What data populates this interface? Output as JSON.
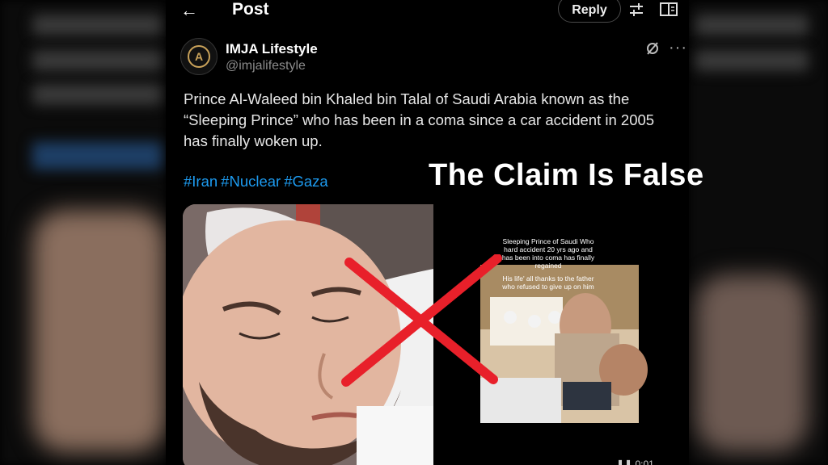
{
  "header": {
    "back_icon": "arrow-left-icon",
    "title": "Post",
    "reply_label": "Reply",
    "filter_icon": "sliders-icon",
    "reader_icon": "book-icon"
  },
  "post": {
    "author": "IMJA Lifestyle",
    "handle": "@imjalifestyle",
    "avatar_letter": "A",
    "text_line1": "Prince Al-Waleed bin Khaled bin Talal of Saudi Arabia known as the",
    "text_line2": "“Sleeping Prince” who has been in a coma since a car accident in 2005",
    "text_line3": "has finally woken up.",
    "hashtags": [
      "#Iran",
      "#Nuclear",
      "#Gaza"
    ],
    "video_time": "0:01"
  },
  "media": {
    "left_image": "sleeping-man-photo",
    "right_video_caption_1": "Sleeping Prince of Saudi Who hard accident 20 yrs ago and has been into coma has finally regained",
    "right_video_caption_2": "His life' all thanks to the father who refused to give up on him"
  },
  "overlay": {
    "claim_text": "The Claim Is False",
    "cross_color": "#e8202a"
  },
  "colors": {
    "link": "#1d9bf0",
    "background": "#000000",
    "text": "#e7e7e7",
    "muted": "#8b8b8b"
  }
}
